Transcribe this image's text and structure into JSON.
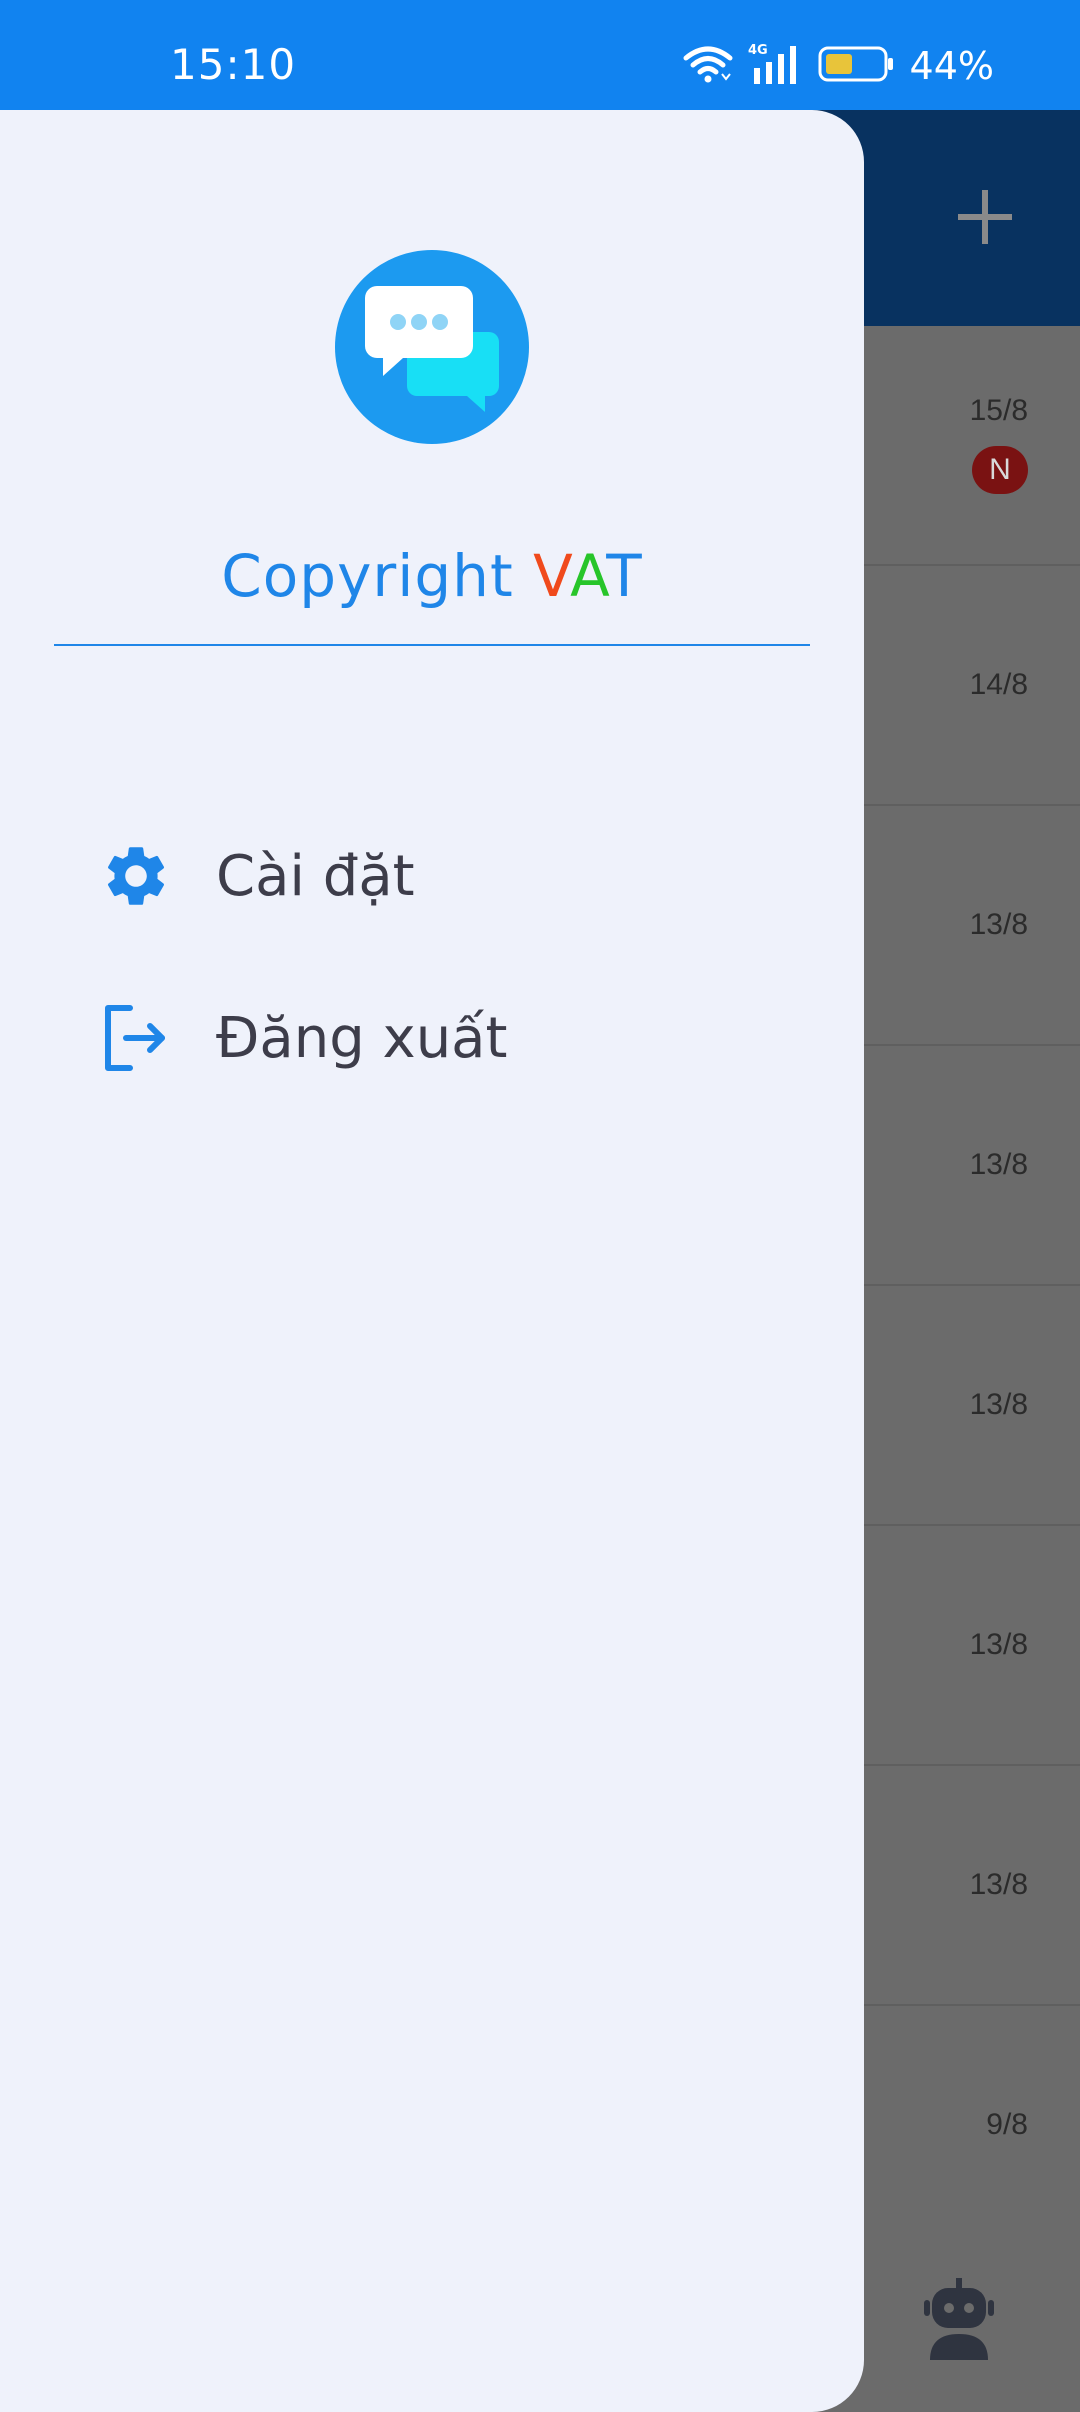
{
  "status_bar": {
    "time": "15:10",
    "network": "4G",
    "battery": "44%",
    "icons": [
      "wifi-icon",
      "signal-icon",
      "battery-icon"
    ]
  },
  "background_app": {
    "header_icon": "add-icon",
    "conversations": [
      {
        "date": "15/8",
        "badge": "N"
      },
      {
        "date": "14/8",
        "badge": ""
      },
      {
        "date": "13/8",
        "badge": ""
      },
      {
        "date": "13/8",
        "badge": ""
      },
      {
        "date": "13/8",
        "badge": ""
      },
      {
        "date": "13/8",
        "badge": ""
      },
      {
        "date": "13/8",
        "badge": ""
      },
      {
        "date": "9/8",
        "badge": ""
      }
    ],
    "bottom_icon": "robot-icon"
  },
  "drawer": {
    "logo_icon": "chat-bubbles-icon",
    "copyright_prefix": "Copyright",
    "brand": {
      "v": "V",
      "a": "A",
      "t": "T"
    },
    "menu": [
      {
        "label": "Cài đặt",
        "icon": "gear-icon"
      },
      {
        "label": "Đăng xuất",
        "icon": "logout-icon"
      }
    ]
  },
  "colors": {
    "status_bar": "#1183f0",
    "header": "#083260",
    "drawer_bg": "#eff2fb",
    "accent": "#1f86e8",
    "brand_v": "#f04a1c",
    "brand_a": "#27c52a",
    "brand_t": "#1f86e8"
  }
}
